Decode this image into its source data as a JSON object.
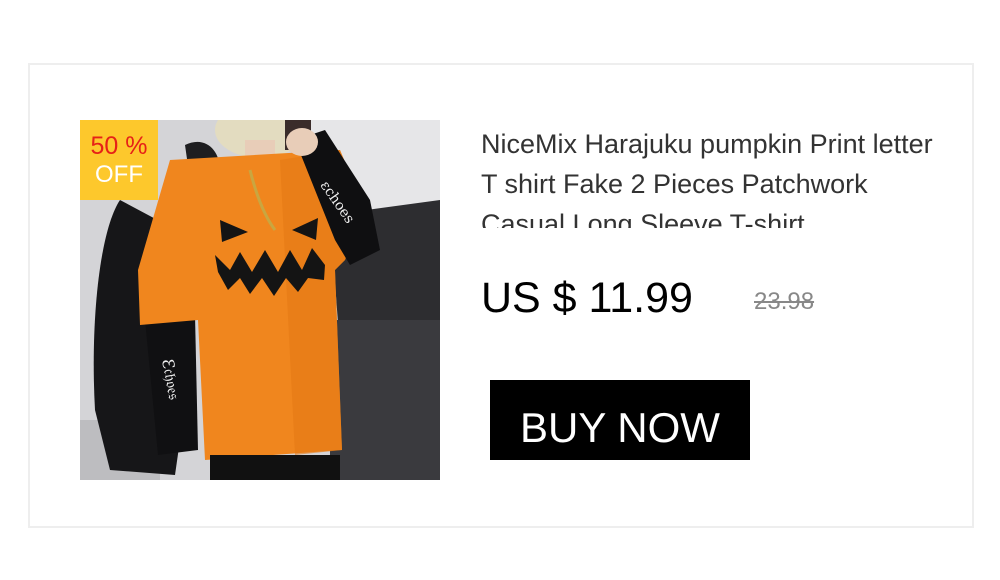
{
  "product": {
    "title": "NiceMix Harajuku pumpkin Print letter T shirt Fake 2 Pieces Patchwork Casual Long Sleeve T-shirt",
    "image_alt": "woman-wearing-orange-pumpkin-face-tshirt-photo"
  },
  "badge": {
    "percent": "50 %",
    "off": "OFF",
    "background": "#fdc82c",
    "percent_color": "#e62117"
  },
  "price": {
    "current": "US $ 11.99",
    "original": "23.98"
  },
  "cta": {
    "label": "BUY NOW",
    "background": "#000000"
  },
  "colors": {
    "shirt": "#f0861e",
    "sleeve": "#111111",
    "title_text": "#333333"
  }
}
